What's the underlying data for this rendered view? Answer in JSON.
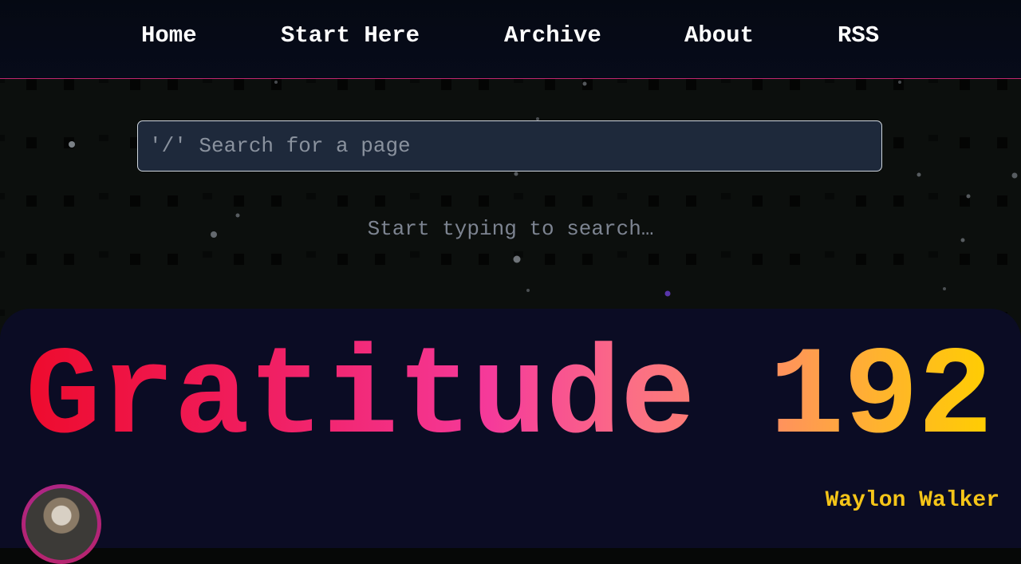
{
  "nav": {
    "items": [
      {
        "label": "Home"
      },
      {
        "label": "Start Here"
      },
      {
        "label": "Archive"
      },
      {
        "label": "About"
      },
      {
        "label": "RSS"
      }
    ]
  },
  "search": {
    "placeholder": "'/' Search for a page",
    "value": "",
    "hint": "Start typing to search…"
  },
  "article": {
    "title": "Gratitude 192",
    "author": "Waylon Walker"
  },
  "colors": {
    "nav_border": "#c2266f",
    "title_gradient": [
      "#ee0b2d",
      "#f53a9a",
      "#ff8f61",
      "#ffce00"
    ],
    "author": "#f5c518",
    "card_bg": "#0b0c24",
    "search_bg": "#1e293b"
  }
}
